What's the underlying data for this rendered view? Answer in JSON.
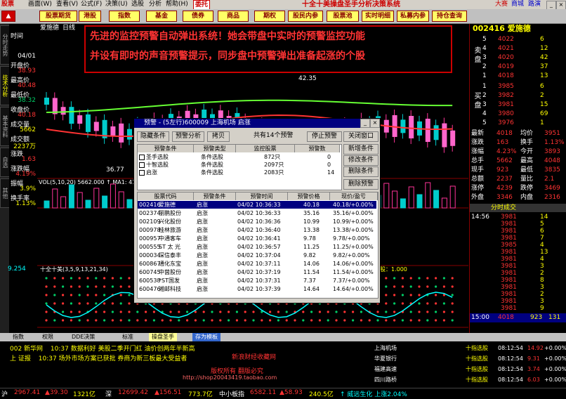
{
  "app": {
    "title": "十全十美操盘圣手分析决策系统",
    "menu": [
      "股票",
      "画面(W)",
      "查看(V)",
      "公式(F)",
      "决策(U)",
      "选股",
      "分析",
      "帮助(H)",
      "委托"
    ],
    "menu_right": [
      "大赛",
      "商城",
      "路演"
    ]
  },
  "toolbar": [
    "股票期货",
    "港股",
    "指数",
    "基金",
    "债券",
    "商品",
    "期权",
    "股民内参",
    "股票池",
    "实时明细",
    "私募内参",
    "持仓查询"
  ],
  "left_tabs": [
    "分时走势",
    "技术分析",
    "基本资料",
    "自选",
    "其他"
  ],
  "left_panel": {
    "rows": [
      {
        "label": "时间",
        "value": ""
      },
      {
        "label": "",
        "value": "04/01"
      },
      {
        "label": "开盘价",
        "value": "38.93"
      },
      {
        "label": "最高价",
        "value": "40.48"
      },
      {
        "label": "最低价",
        "value": "38.32"
      },
      {
        "label": "收盘价",
        "value": "40.18"
      },
      {
        "label": "成交量",
        "value": "5662"
      },
      {
        "label": "成交额",
        "value": "2237万"
      },
      {
        "label": "涨跌",
        "value": "1.63"
      },
      {
        "label": "涨跌幅",
        "value": "4.19%"
      },
      {
        "label": "振幅",
        "value": "3.9%"
      },
      {
        "label": "换手率",
        "value": "1.13%"
      }
    ],
    "bottom_value": "9.254",
    "badge": "换票 网创"
  },
  "banner": {
    "line1": "先进的监控预警自动弹出系统！她会带盘中实时的预警监控功能",
    "line2": "并设有即时的声音预警提示，同步盘中预警弹出准备起涨的个股"
  },
  "chart": {
    "labels": {
      "indicator": "VOL(5,10,20) 5662.000 ↑ MA1: 4198",
      "lower": "十全十美(3,5,9,13,21,34)",
      "date_label": "2011",
      "date_right": "2011/04/01[五]",
      "sel_label": "选股：1.000",
      "price_high": "42.35",
      "price_low": "36.77",
      "kline_name": "爱施德",
      "kline_period": "日线"
    }
  },
  "right_panel": {
    "code": "002416 爱施德",
    "sell": [
      {
        "n": "5",
        "p": "4022",
        "v": "6"
      },
      {
        "n": "4",
        "p": "4021",
        "v": "12"
      },
      {
        "n": "3",
        "p": "4020",
        "v": "42"
      },
      {
        "n": "2",
        "p": "4019",
        "v": "37"
      },
      {
        "n": "1",
        "p": "4018",
        "v": "13"
      }
    ],
    "buy": [
      {
        "n": "1",
        "p": "3985",
        "v": "6"
      },
      {
        "n": "2",
        "p": "3982",
        "v": "2"
      },
      {
        "n": "3",
        "p": "3981",
        "v": "15"
      },
      {
        "n": "4",
        "p": "3980",
        "v": "69"
      },
      {
        "n": "5",
        "p": "3976",
        "v": "1"
      }
    ],
    "stats": [
      {
        "a": "最新",
        "b": "4018",
        "c": "均价",
        "d": "3951"
      },
      {
        "a": "涨跌",
        "b": "163",
        "c": "换手",
        "d": "1.13%"
      },
      {
        "a": "涨幅",
        "b": "4.23%",
        "c": "今开",
        "d": "3893"
      },
      {
        "a": "总手",
        "b": "5662",
        "c": "最高",
        "d": "4048"
      },
      {
        "a": "现手",
        "b": "923",
        "c": "最低",
        "d": "3835"
      },
      {
        "a": "总额",
        "b": "2237",
        "c": "量比",
        "d": "2.1"
      },
      {
        "a": "涨停",
        "b": "4239",
        "c": "跌停",
        "d": "3469"
      },
      {
        "a": "外盘",
        "b": "3346",
        "c": "内盘",
        "d": "2316"
      }
    ],
    "trades_title": "分时成交",
    "trades": [
      {
        "t": "14:56",
        "p": "3981",
        "v": "14"
      },
      {
        "t": "",
        "p": "3981",
        "v": "5"
      },
      {
        "t": "",
        "p": "3981",
        "v": "6"
      },
      {
        "t": "",
        "p": "3981",
        "v": "7"
      },
      {
        "t": "",
        "p": "3985",
        "v": "4"
      },
      {
        "t": "",
        "p": "3981",
        "v": "13"
      },
      {
        "t": "",
        "p": "3981",
        "v": "4"
      },
      {
        "t": "",
        "p": "3981",
        "v": "3"
      },
      {
        "t": "",
        "p": "3981",
        "v": "2"
      },
      {
        "t": "",
        "p": "3981",
        "v": "8"
      },
      {
        "t": "",
        "p": "3981",
        "v": "3"
      },
      {
        "t": "",
        "p": "3981",
        "v": "2"
      },
      {
        "t": "",
        "p": "3981",
        "v": "3"
      },
      {
        "t": "",
        "p": "3981",
        "v": "9"
      }
    ],
    "last": {
      "t": "15:00",
      "p": "4018",
      "v": "923",
      "x": "131"
    }
  },
  "dialog": {
    "title": "预警 - (5左行)600009 上海机场 启涨",
    "buttons_top": [
      "隐藏条件",
      "预警分析",
      "拷贝",
      "共有14个预警",
      "停止预警",
      "关闭窗口"
    ],
    "cond_headers": [
      "预警条件",
      "预警类型",
      "监控股票",
      "预警数"
    ],
    "conds": [
      {
        "name": "圣手选股",
        "type": "条件选股",
        "stocks": "872只",
        "count": "0"
      },
      {
        "name": "十智选股",
        "type": "条件选股",
        "stocks": "2097只",
        "count": "0"
      },
      {
        "name": "启涨",
        "type": "条件选股",
        "stocks": "2083只",
        "count": "14"
      }
    ],
    "side_buttons": [
      "新增条件",
      "修改条件",
      "删除条件",
      "删除预警"
    ],
    "alert_headers": [
      "股票代码",
      "预警条件",
      "预警时间",
      "预警价格",
      "现价/盈亏"
    ],
    "alerts": [
      {
        "code": "002416",
        "name": "爱施德",
        "cond": "启涨",
        "time": "04/02 10:36:33",
        "price": "40.18",
        "pl": "40.18/+0.00%"
      },
      {
        "code": "002374",
        "name": "丽鹏股份",
        "cond": "启涨",
        "time": "04/02 10:36:33",
        "price": "35.16",
        "pl": "35.16/+0.00%"
      },
      {
        "code": "002109",
        "name": "兴化股份",
        "cond": "启涨",
        "time": "04/02 10:36:36",
        "price": "10.99",
        "pl": "10.99/+0.00%"
      },
      {
        "code": "000978",
        "name": "桂林旅游",
        "cond": "启涨",
        "time": "04/02 10:36:40",
        "price": "13.38",
        "pl": "13.38/+0.00%"
      },
      {
        "code": "000957",
        "name": "中通客车",
        "cond": "启涨",
        "time": "04/02 10:36:41",
        "price": "9.78",
        "pl": "9.78/+0.00%"
      },
      {
        "code": "000555",
        "name": "ST 太 光",
        "cond": "启涨",
        "time": "04/02 10:36:57",
        "price": "11.25",
        "pl": "11.25/+0.00%"
      },
      {
        "code": "000034",
        "name": "深信泰丰",
        "cond": "启涨",
        "time": "04/02 10:37:04",
        "price": "9.82",
        "pl": "9.82/+0.00%"
      },
      {
        "code": "600867",
        "name": "通化东宝",
        "cond": "启涨",
        "time": "04/02 10:37:11",
        "price": "14.06",
        "pl": "14.06/+0.00%"
      },
      {
        "code": "600745",
        "name": "中茵股份",
        "cond": "启涨",
        "time": "04/02 10:37:19",
        "price": "11.54",
        "pl": "11.54/+0.00%"
      },
      {
        "code": "600538",
        "name": "*ST国发",
        "cond": "启涨",
        "time": "04/02 10:37:31",
        "price": "7.37",
        "pl": "7.37/+0.00%"
      },
      {
        "code": "600476",
        "name": "湘邮科技",
        "cond": "启涨",
        "time": "04/02 10:37:39",
        "price": "14.64",
        "pl": "14.64/+0.00%"
      }
    ]
  },
  "bottom_tabs": [
    "指数",
    "权限",
    "DDE决策",
    "标准",
    "操盘圣手",
    "存为模板"
  ],
  "news": [
    {
      "src": "002 新华网",
      "time": "10:37",
      "text": "数据利好 美股二季开门红 油价创两年半新高"
    },
    {
      "src": "上 证报",
      "time": "10:37",
      "text": "场外市场方案已获批 券商为新三板最大受益者"
    }
  ],
  "watermark": {
    "line1": "新浪财经收藏网",
    "line2": "版权所有 翻版必究",
    "url": "http://shop20043419.taobao.com"
  },
  "right_alerts": [
    {
      "name": "上海机场",
      "tag": "十指选股",
      "time": "08:12:54",
      "v1": "14.92",
      "v2": "+0.00%"
    },
    {
      "name": "华夏银行",
      "tag": "十指选股",
      "time": "08:12:54",
      "v1": "9.31",
      "v2": "+0.00%"
    },
    {
      "name": "福建高速",
      "tag": "十指选股",
      "time": "08:12:54",
      "v1": "3.74",
      "v2": "+0.00%"
    },
    {
      "name": "四川路桥",
      "tag": "十指选股",
      "time": "08:12:54",
      "v1": "6.03",
      "v2": "+0.00%"
    }
  ],
  "status": [
    "沪",
    "2967.41",
    "▲39.30",
    "1321亿",
    "深",
    "12699.42",
    "▲156.51",
    "773.7亿",
    "中小板指",
    "6582.11",
    "▲58.93",
    "240.5亿",
    "↑ 威远生化 上涨2.04%"
  ],
  "colors": {
    "up": "#ff3333",
    "down": "#00cc66",
    "accent": "#ffff00",
    "cyan": "#00ffff"
  }
}
